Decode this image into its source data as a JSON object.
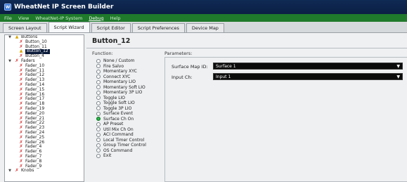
{
  "app": {
    "title": "WheatNet IP Screen Builder",
    "icon": "wheatnet-logo-icon"
  },
  "menu": [
    "File",
    "View",
    "WheatNet-IP System",
    "Debug",
    "Help"
  ],
  "tabs": [
    "Screen Layout",
    "Script Wizard",
    "Script Editor",
    "Script Preferences",
    "Device Map"
  ],
  "tree": [
    {
      "label": "Buttons",
      "level": 0,
      "expander": "▼",
      "icon": "warn"
    },
    {
      "label": "Button_10",
      "level": 1,
      "icon": "x"
    },
    {
      "label": "Button_11",
      "level": 1,
      "icon": "x"
    },
    {
      "label": "Button_12",
      "level": 1,
      "icon": "warn",
      "selected": true
    },
    {
      "label": "Button_4",
      "level": 1,
      "icon": "x"
    },
    {
      "label": "Faders",
      "level": 0,
      "expander": "▼",
      "icon": "x"
    },
    {
      "label": "Fader_10",
      "level": 1,
      "icon": "x"
    },
    {
      "label": "Fader_11",
      "level": 1,
      "icon": "x"
    },
    {
      "label": "Fader_12",
      "level": 1,
      "icon": "x"
    },
    {
      "label": "Fader_13",
      "level": 1,
      "icon": "x"
    },
    {
      "label": "Fader_14",
      "level": 1,
      "icon": "x"
    },
    {
      "label": "Fader_15",
      "level": 1,
      "icon": "x"
    },
    {
      "label": "Fader_16",
      "level": 1,
      "icon": "x"
    },
    {
      "label": "Fader_17",
      "level": 1,
      "icon": "x"
    },
    {
      "label": "Fader_18",
      "level": 1,
      "icon": "x"
    },
    {
      "label": "Fader_19",
      "level": 1,
      "icon": "x"
    },
    {
      "label": "Fader_20",
      "level": 1,
      "icon": "x"
    },
    {
      "label": "Fader_21",
      "level": 1,
      "icon": "x"
    },
    {
      "label": "Fader_22",
      "level": 1,
      "icon": "x"
    },
    {
      "label": "Fader_23",
      "level": 1,
      "icon": "x"
    },
    {
      "label": "Fader_24",
      "level": 1,
      "icon": "x"
    },
    {
      "label": "Fader_25",
      "level": 1,
      "icon": "x"
    },
    {
      "label": "Fader_26",
      "level": 1,
      "icon": "x"
    },
    {
      "label": "Fader_4",
      "level": 1,
      "icon": "x"
    },
    {
      "label": "Fader_6",
      "level": 1,
      "icon": "x"
    },
    {
      "label": "Fader_7",
      "level": 1,
      "icon": "x"
    },
    {
      "label": "Fader_8",
      "level": 1,
      "icon": "x"
    },
    {
      "label": "Fader_9",
      "level": 1,
      "icon": "x"
    },
    {
      "label": "Knobs",
      "level": 0,
      "expander": "▼",
      "icon": "x"
    }
  ],
  "panel": {
    "title": "Button_12",
    "function_label": "Function:",
    "parameters_label": "Parameters:",
    "functions": [
      {
        "label": "None / Custom",
        "selected": false
      },
      {
        "label": "Fire Salvo",
        "selected": false
      },
      {
        "label": "Momentary XYC",
        "selected": false
      },
      {
        "label": "Connect XYC",
        "selected": false
      },
      {
        "label": "Momentary LIO",
        "selected": false
      },
      {
        "label": "Momentary Soft LIO",
        "selected": false
      },
      {
        "label": "Momentary 3P LIO",
        "selected": false
      },
      {
        "label": "Toggle LIO",
        "selected": false
      },
      {
        "label": "Toggle Soft LIO",
        "selected": false
      },
      {
        "label": "Toggle 3P LIO",
        "selected": false
      },
      {
        "label": "Surface Event",
        "selected": false
      },
      {
        "label": "Surface Ch On",
        "selected": true
      },
      {
        "label": "AP Preset",
        "selected": false
      },
      {
        "label": "Util Mix Ch On",
        "selected": false
      },
      {
        "label": "ACI Command",
        "selected": false
      },
      {
        "label": "Local Timer Control",
        "selected": false
      },
      {
        "label": "Group Timer Control",
        "selected": false
      },
      {
        "label": "OS Command",
        "selected": false
      },
      {
        "label": "Exit",
        "selected": false
      }
    ],
    "params": [
      {
        "label": "Surface Map ID:",
        "value": "Surface 1"
      },
      {
        "label": "Input Ch:",
        "value": "Input 1"
      }
    ]
  },
  "colors": {
    "menubar": "#1f7a2b",
    "titlebar": "#0f2a54",
    "selected_radio": "#2ec44d",
    "error_x": "#d42020"
  }
}
